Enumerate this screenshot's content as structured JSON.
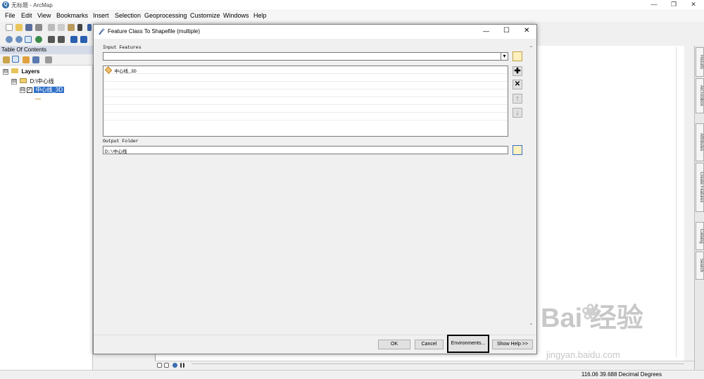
{
  "window": {
    "title": "无标题 - ArcMap",
    "app_icon": "Q",
    "minimize": "—",
    "restore": "❐",
    "close": "✕"
  },
  "menu": [
    "File",
    "Edit",
    "View",
    "Bookmarks",
    "Insert",
    "Selection",
    "Geoprocessing",
    "Customize",
    "Windows",
    "Help"
  ],
  "toc": {
    "title": "Table Of Contents",
    "layers_label": "Layers",
    "folder_label": "D:\\中心线",
    "layer_label": "中心线_3D",
    "expand_symbol": "⊟",
    "check_symbol": "✓"
  },
  "dialog": {
    "title": "Feature Class To Shapefile (multiple)",
    "minimize": "—",
    "maximize": "☐",
    "close": "✕",
    "input_label": "Input Features",
    "input_value": "",
    "input_list": [
      "中心线_3D"
    ],
    "output_label": "Output Folder",
    "output_value": "D:\\中心线",
    "add_symbol": "✚",
    "remove_symbol": "✕",
    "up_symbol": "↑",
    "down_symbol": "↓",
    "scroll_up": "⌃",
    "scroll_down": "⌄",
    "dropdown_arrow": "▾",
    "buttons": {
      "ok": "OK",
      "cancel": "Cancel",
      "environments": "Environments...",
      "show_help": "Show Help >>"
    }
  },
  "dock_tabs": [
    "Results",
    "ArcToolbox",
    "Attributes",
    "Create Features",
    "Catalog",
    "Search"
  ],
  "status": {
    "coordinates": "116.06  39.688 Decimal Degrees"
  },
  "watermark": {
    "text": "Bai 经验",
    "paw": "❀",
    "url": "jingyan.baidu.com"
  }
}
